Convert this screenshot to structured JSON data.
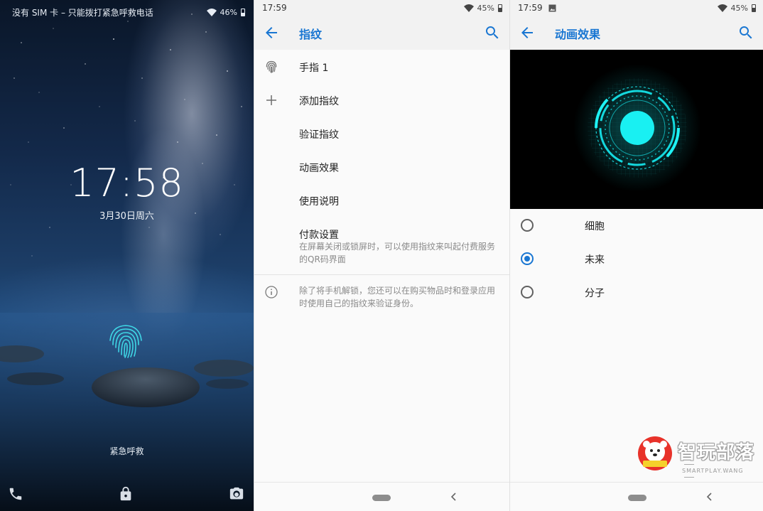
{
  "lockscreen": {
    "status_text": "没有 SIM 卡 – 只能拨打紧急呼救电话",
    "battery": "46%",
    "time": "17:58",
    "date": "3月30日周六",
    "emergency_label": "紧急呼救"
  },
  "fingerprint_screen": {
    "status_time": "17:59",
    "battery": "45%",
    "title": "指纹",
    "items": [
      {
        "label": "手指 1",
        "icon": "fingerprint-icon"
      },
      {
        "label": "添加指纹",
        "icon": "plus-icon"
      },
      {
        "label": "验证指纹"
      },
      {
        "label": "动画效果"
      },
      {
        "label": "使用说明"
      },
      {
        "label": "付款设置",
        "description": "在屏幕关闭或锁屏时，可以使用指纹来叫起付费服务的QR码界面"
      }
    ],
    "info_text": "除了将手机解锁，您还可以在购买物品时和登录应用时使用自己的指纹来验证身份。"
  },
  "animation_screen": {
    "status_time": "17:59",
    "battery": "45%",
    "title": "动画效果",
    "options": [
      {
        "label": "细胞",
        "selected": false
      },
      {
        "label": "未来",
        "selected": true
      },
      {
        "label": "分子",
        "selected": false
      }
    ],
    "watermark": {
      "text": "智玩部落",
      "sub": "SMARTPLAY.WANG",
      "logo_text": "智玩部落"
    }
  },
  "colors": {
    "accent": "#1976d2",
    "preview_glow": "#16e3e8"
  }
}
